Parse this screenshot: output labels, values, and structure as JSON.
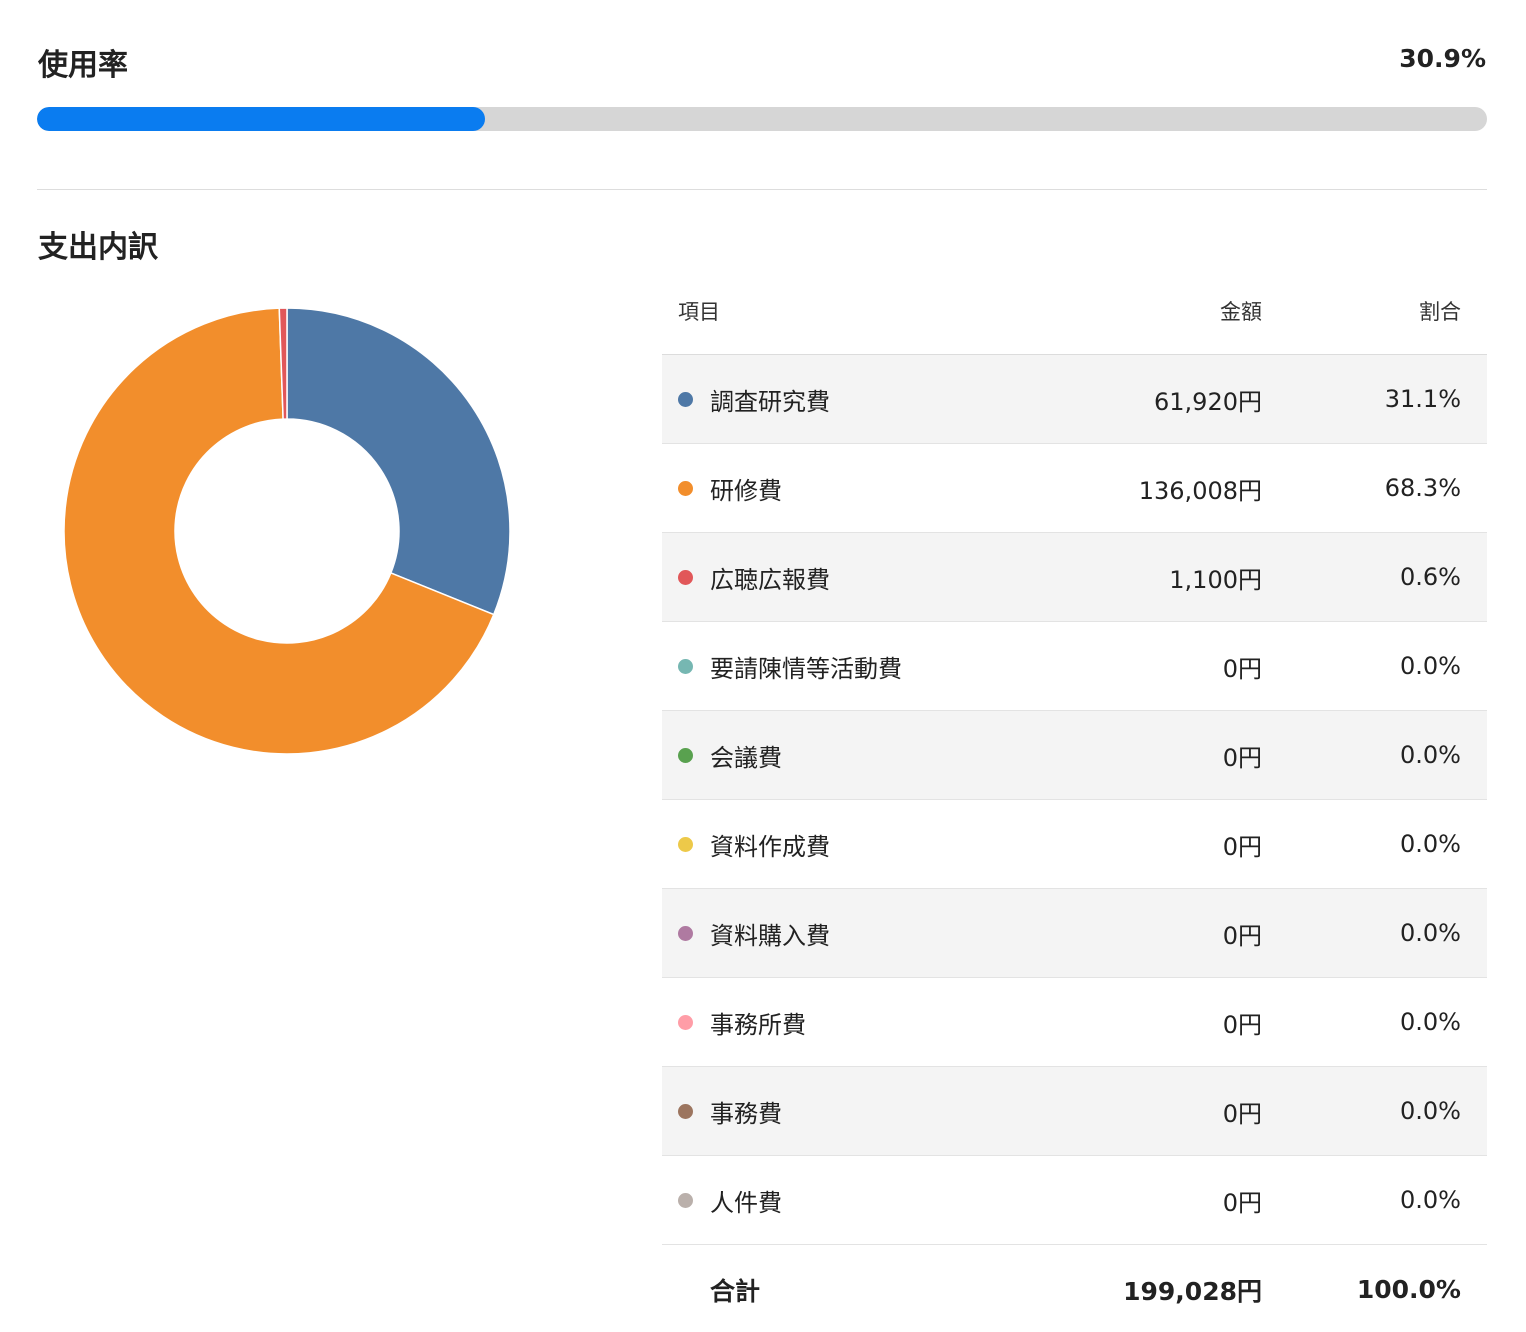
{
  "usage": {
    "title": "使用率",
    "value_label": "30.9%",
    "fraction": 0.309,
    "bar_color": "#0a7cf0",
    "track_color": "#d6d6d6"
  },
  "breakdown": {
    "title": "支出内訳",
    "columns": {
      "item": "項目",
      "amount": "金額",
      "percent": "割合"
    },
    "rows": [
      {
        "label": "調査研究費",
        "amount": "61,920円",
        "percent": "31.1%",
        "color": "#4e78a6"
      },
      {
        "label": "研修費",
        "amount": "136,008円",
        "percent": "68.3%",
        "color": "#f28e2c"
      },
      {
        "label": "広聴広報費",
        "amount": "1,100円",
        "percent": "0.6%",
        "color": "#e15759"
      },
      {
        "label": "要請陳情等活動費",
        "amount": "0円",
        "percent": "0.0%",
        "color": "#76b7b2"
      },
      {
        "label": "会議費",
        "amount": "0円",
        "percent": "0.0%",
        "color": "#59a14f"
      },
      {
        "label": "資料作成費",
        "amount": "0円",
        "percent": "0.0%",
        "color": "#edc949"
      },
      {
        "label": "資料購入費",
        "amount": "0円",
        "percent": "0.0%",
        "color": "#af7aa1"
      },
      {
        "label": "事務所費",
        "amount": "0円",
        "percent": "0.0%",
        "color": "#ff9da7"
      },
      {
        "label": "事務費",
        "amount": "0円",
        "percent": "0.0%",
        "color": "#9c755f"
      },
      {
        "label": "人件費",
        "amount": "0円",
        "percent": "0.0%",
        "color": "#bab0ab"
      }
    ],
    "total": {
      "label": "合計",
      "amount": "199,028円",
      "percent": "100.0%"
    }
  },
  "chart_data": {
    "type": "pie",
    "donut": true,
    "categories": [
      "調査研究費",
      "研修費",
      "広聴広報費",
      "要請陳情等活動費",
      "会議費",
      "資料作成費",
      "資料購入費",
      "事務所費",
      "事務費",
      "人件費"
    ],
    "values": [
      61920,
      136008,
      1100,
      0,
      0,
      0,
      0,
      0,
      0,
      0
    ],
    "colors": [
      "#4e78a6",
      "#f28e2c",
      "#e15759",
      "#76b7b2",
      "#59a14f",
      "#edc949",
      "#af7aa1",
      "#ff9da7",
      "#9c755f",
      "#bab0ab"
    ],
    "title": "",
    "legend": "table-right"
  }
}
